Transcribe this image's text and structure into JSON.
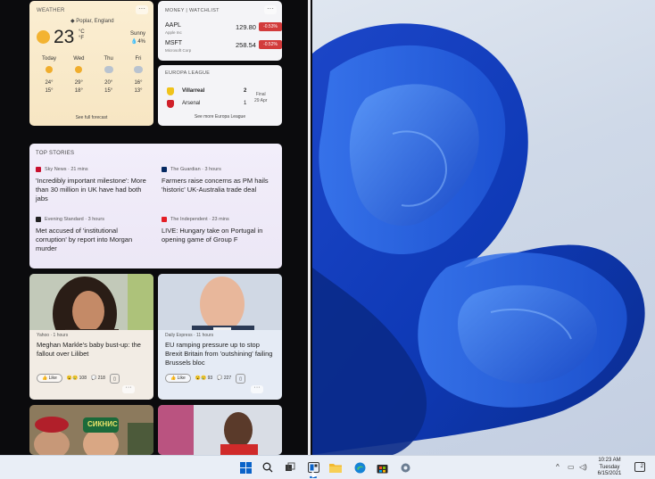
{
  "weather": {
    "title": "WEATHER",
    "location": "◆ Poplar, England",
    "temp": "23",
    "unit_c": "°C",
    "unit_f": "°F",
    "condition": "Sunny",
    "precip": "💧4%",
    "days": [
      {
        "name": "Today",
        "icon": "sun-icon",
        "hi": "24°",
        "lo": "15°"
      },
      {
        "name": "Wed",
        "icon": "sun-icon",
        "hi": "29°",
        "lo": "18°"
      },
      {
        "name": "Thu",
        "icon": "cloud-rain-icon",
        "hi": "20°",
        "lo": "15°"
      },
      {
        "name": "Fri",
        "icon": "cloud-rain-icon",
        "hi": "16°",
        "lo": "13°"
      }
    ],
    "link": "See full forecast"
  },
  "watchlist": {
    "title": "MONEY | WATCHLIST",
    "stocks": [
      {
        "symbol": "AAPL",
        "company": "Apple Inc",
        "price": "129.80",
        "change": "-0.53%"
      },
      {
        "symbol": "MSFT",
        "company": "Microsoft Corp",
        "price": "258.54",
        "change": "-0.52%"
      }
    ]
  },
  "europa": {
    "title": "EUROPA LEAGUE",
    "teams": [
      {
        "name": "Villarreal",
        "score": "2",
        "color": "#f0c31b"
      },
      {
        "name": "Arsenal",
        "score": "1",
        "color": "#d0202a"
      }
    ],
    "status_1": "Final",
    "status_2": "29 Apr",
    "link": "See more Europa League"
  },
  "top_stories": {
    "title": "TOP STORIES",
    "items": [
      {
        "source": "Sky News · 21 mins",
        "logo_color": "#c8102e",
        "headline": "'Incredibly important milestone': More than 30 million in UK have had both jabs"
      },
      {
        "source": "The Guardian · 3 hours",
        "logo_color": "#052962",
        "headline": "Farmers raise concerns as PM hails 'historic' UK-Australia trade deal"
      },
      {
        "source": "Evening Standard · 3 hours",
        "logo_color": "#222222",
        "headline": "Met accused of 'institutional corruption' by report into Morgan murder"
      },
      {
        "source": "The Independent · 23 mins",
        "logo_color": "#e41e26",
        "headline": "LIVE: Hungary take on Portugal in opening game of Group F"
      }
    ]
  },
  "news_cards": [
    {
      "source": "Yahoo · 1 hours",
      "headline": "Meghan Markle's baby bust-up: the fallout over Lilibet",
      "like": "Like",
      "count1": "108",
      "count2": "218"
    },
    {
      "source": "Daily Express · 11 hours",
      "headline": "EU ramping pressure up to stop Brexit Britain from 'outshining' failing Brussels bloc",
      "like": "Like",
      "count1": "93",
      "count2": "227"
    }
  ],
  "bottom_cards": {
    "left_text": "СИКНИС"
  },
  "taskbar": {
    "icons": [
      "windows-start-icon",
      "search-icon",
      "task-view-icon",
      "widgets-icon",
      "file-explorer-icon",
      "edge-icon",
      "store-icon",
      "settings-icon"
    ],
    "time": "10:23 AM",
    "day": "Tuesday",
    "date": "6/15/2021",
    "notifications": "2",
    "accent": "#0a63c9"
  }
}
